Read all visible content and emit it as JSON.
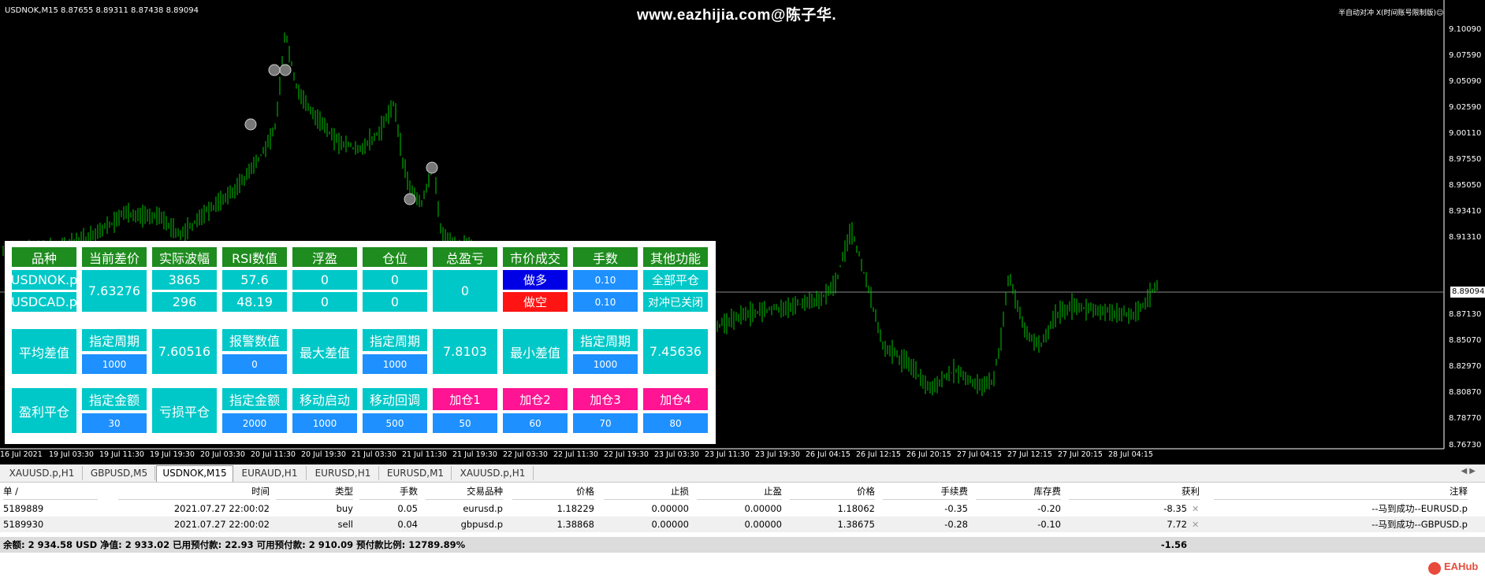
{
  "chart": {
    "symbol": "USDNOK,M15  8.87655 8.89311 8.87438 8.89094",
    "watermark": "www.eazhijia.com@陈子华.",
    "top_right": "半自动对冲 X(时间账号限制版)☺",
    "current_price": "8.89094",
    "price_scale": [
      "9.10090",
      "9.07590",
      "9.05090",
      "9.02590",
      "9.00110",
      "8.97550",
      "8.95050",
      "8.93410",
      "8.91310",
      "8.87130",
      "8.85070",
      "8.82970",
      "8.80870",
      "8.78770",
      "8.76730"
    ],
    "time_scale": [
      "16 Jul 2021",
      "19 Jul 03:30",
      "19 Jul 11:30",
      "19 Jul 19:30",
      "20 Jul 03:30",
      "20 Jul 11:30",
      "20 Jul 19:30",
      "21 Jul 03:30",
      "21 Jul 11:30",
      "21 Jul 19:30",
      "22 Jul 03:30",
      "22 Jul 11:30",
      "22 Jul 19:30",
      "23 Jul 03:30",
      "23 Jul 11:30",
      "23 Jul 19:30",
      "26 Jul 04:15",
      "26 Jul 12:15",
      "26 Jul 20:15",
      "27 Jul 04:15",
      "27 Jul 12:15",
      "27 Jul 20:15",
      "28 Jul 04:15"
    ],
    "candle_color": "#00c800"
  },
  "panel": {
    "headers": [
      "品种",
      "当前差价",
      "实际波幅",
      "RSI数值",
      "浮盈",
      "仓位",
      "总盈亏",
      "市价成交",
      "手数",
      "其他功能"
    ],
    "sym1": "USDNOK.p",
    "sym2": "USDCAD.p",
    "spread": "7.63276",
    "wave1": "3865",
    "wave2": "296",
    "rsi1": "57.6",
    "rsi2": "48.19",
    "float1": "0",
    "float2": "0",
    "pos1": "0",
    "pos2": "0",
    "total_pl": "0",
    "buy_label": "做多",
    "sell_label": "做空",
    "lot1": "0.10",
    "lot2": "0.10",
    "close_all": "全部平仓",
    "hedge_status": "对冲已关闭",
    "avg_spread_label": "平均差值",
    "period_label": "指定周期",
    "period_value": "1000",
    "avg_spread_value": "7.60516",
    "alert_label": "报警数值",
    "alert_value": "0",
    "max_spread_label": "最大差值",
    "period2_label": "指定周期",
    "period2_value": "1000",
    "max_spread_value": "7.8103",
    "min_spread_label": "最小差值",
    "period3_label": "指定周期",
    "period3_value": "1000",
    "min_spread_value": "7.45636",
    "tp_close_label": "盈利平仓",
    "amount_label": "指定金额",
    "amount_value": "30",
    "sl_close_label": "亏损平仓",
    "amount2_label": "指定金额",
    "amount2_value": "2000",
    "trail_start_label": "移动启动",
    "trail_start_value": "1000",
    "trail_back_label": "移动回调",
    "trail_back_value": "500",
    "add1_label": "加仓1",
    "add1_value": "50",
    "add2_label": "加仓2",
    "add2_value": "60",
    "add3_label": "加仓3",
    "add3_value": "70",
    "add4_label": "加仓4",
    "add4_value": "80"
  },
  "tabs": [
    "XAUUSD.p,H1",
    "GBPUSD,M5",
    "USDNOK,M15",
    "EURAUD,H1",
    "EURUSD,H1",
    "EURUSD,M1",
    "XAUUSD.p,H1"
  ],
  "active_tab": "USDNOK,M15",
  "trade": {
    "columns": [
      "单 /",
      "时间",
      "类型",
      "手数",
      "交易品种",
      "价格",
      "止损",
      "止盈",
      "价格",
      "手续费",
      "库存费",
      "获利",
      "注释"
    ],
    "rows": [
      {
        "ticket": "5189889",
        "time": "2021.07.27 22:00:02",
        "type": "buy",
        "lots": "0.05",
        "symbol": "eurusd.p",
        "price": "1.18229",
        "sl": "0.00000",
        "tp": "0.00000",
        "cur": "1.18062",
        "commission": "-0.35",
        "swap": "-0.20",
        "profit": "-8.35",
        "comment": "--马到成功--EURUSD.p"
      },
      {
        "ticket": "5189930",
        "time": "2021.07.27 22:00:02",
        "type": "sell",
        "lots": "0.04",
        "symbol": "gbpusd.p",
        "price": "1.38868",
        "sl": "0.00000",
        "tp": "0.00000",
        "cur": "1.38675",
        "commission": "-0.28",
        "swap": "-0.10",
        "profit": "7.72",
        "comment": "--马到成功--GBPUSD.p"
      }
    ],
    "summary": "余额: 2 934.58 USD  净值: 2 933.02  已用预付款: 22.93  可用预付款: 2 910.09  预付款比例: 12789.89%",
    "summary_profit": "-1.56"
  },
  "brand": "EAHub"
}
